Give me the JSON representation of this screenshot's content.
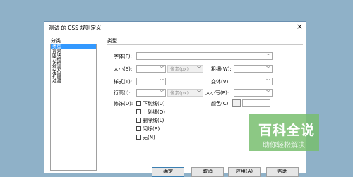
{
  "dialog": {
    "title": "测试 的 CSS 规则定义",
    "close_glyph": "×"
  },
  "category": {
    "header": "分类",
    "items": [
      "类型",
      "背景",
      "区块",
      "方框",
      "边框",
      "列表",
      "定位",
      "扩展",
      "过渡"
    ],
    "selected_index": 0
  },
  "type_panel": {
    "header": "类型",
    "font_family_label": "字体(F):",
    "font_size_label": "大小(S):",
    "font_size_unit": "像素(px)",
    "font_weight_label": "粗细(W):",
    "font_style_label": "样式(T):",
    "font_variant_label": "变体(V):",
    "line_height_label": "行高(I):",
    "line_height_unit": "像素(px)",
    "text_transform_label": "大小写(E):",
    "decoration_label": "修饰(D):",
    "decorations": [
      "下划线(U)",
      "上划线(O)",
      "删除线(L)",
      "闪烁(B)",
      "无(N)"
    ],
    "color_label": "颜色(C):"
  },
  "buttons": {
    "ok": "确定",
    "cancel": "取消",
    "apply": "应用(A)",
    "help": "帮助"
  },
  "watermark": {
    "title": "百科全说",
    "subtitle": "助你轻松解决"
  }
}
